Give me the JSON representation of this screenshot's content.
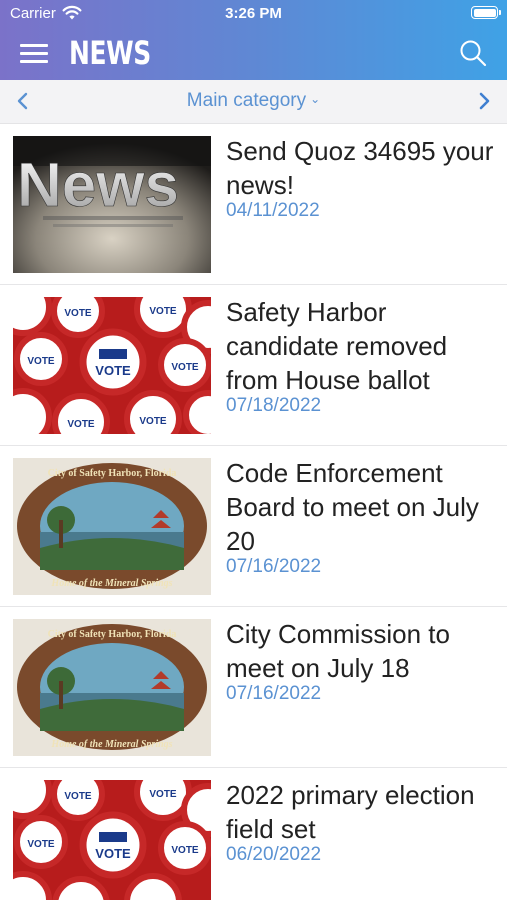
{
  "status_bar": {
    "carrier": "Carrier",
    "time": "3:26 PM"
  },
  "nav": {
    "title": "NEWS",
    "menu_icon": "hamburger-icon",
    "search_icon": "search-icon"
  },
  "category": {
    "label": "Main category",
    "prev_icon": "chevron-left-icon",
    "next_icon": "chevron-right-icon"
  },
  "thumb_texts": {
    "news": "News",
    "vote": "VOTE",
    "seal_top": "City of Safety Harbor, Florida",
    "seal_bottom": "Home of the Mineral Springs"
  },
  "articles": [
    {
      "title": "Send Quoz 34695 your news!",
      "date": "04/11/2022",
      "thumb": "news"
    },
    {
      "title": "Safety Harbor candidate removed from House ballot",
      "date": "07/18/2022",
      "thumb": "vote"
    },
    {
      "title": "Code Enforcement Board to meet on July 20",
      "date": "07/16/2022",
      "thumb": "seal"
    },
    {
      "title": "City Commission to meet on July 18",
      "date": "07/16/2022",
      "thumb": "seal"
    },
    {
      "title": "2022 primary election field set",
      "date": "06/20/2022",
      "thumb": "vote"
    }
  ],
  "colors": {
    "header_start": "#7b72c9",
    "header_end": "#3fa2e6",
    "accent": "#5b92d2"
  }
}
